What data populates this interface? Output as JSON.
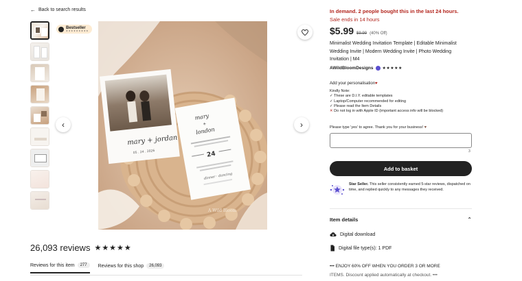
{
  "nav": {
    "back_label": "Back to search results"
  },
  "badge": {
    "label": "Bestseller",
    "sub": "★★★★★★★★★"
  },
  "gallery": {
    "thumbnail_count": 9,
    "card_names": "mary + jordan",
    "card_date": "05 . 24 . 2026",
    "card2_names": "mary + london",
    "card2_day": "24",
    "card_watermark": "A Wild Bloom"
  },
  "reviews": {
    "title": "26,093 reviews",
    "stars": "★★★★★",
    "tabs": [
      {
        "label": "Reviews for this item",
        "count": "277"
      },
      {
        "label": "Reviews for this shop",
        "count": "26,093"
      }
    ]
  },
  "listing": {
    "demand": "In demand. 2 people bought this in the last 24 hours.",
    "sale_ends": "Sale ends in 14 hours",
    "price_now": "$5.99",
    "price_was": "$9.99",
    "discount": "(40% Off)",
    "title": "Minimalist Wedding Invitation Template | Editable Minimalist Wedding Invite | Modern Wedding Invite | Photo Wedding Invitation | M4",
    "shop_name": "AWildBloomDesigns",
    "shop_stars": "★★★★★"
  },
  "personalisation": {
    "label": "Add your personalisation",
    "required_mark": "♥",
    "notes": [
      "Kindly Note:",
      "✓ These are D.I.Y. editable templates",
      "✓ Laptop/Computer recommended for editing",
      "✓ Please read the Item Details"
    ],
    "warning": "Do not log in with Apple ID (important access info will be blocked)",
    "prompt": "Please type 'yes' to agree. Thank you for your business!",
    "counter": "3"
  },
  "cta": {
    "add_to_basket": "Add to basket"
  },
  "star_seller": {
    "title": "Star Seller.",
    "text": "This seller consistently earned 5-star reviews, dispatched on time, and replied quickly to any messages they received."
  },
  "details": {
    "heading": "Item details",
    "items": [
      {
        "icon": "download-icon",
        "label": "Digital download"
      },
      {
        "icon": "file-icon",
        "label": "Digital file type(s): 1 PDF"
      }
    ],
    "promo_line1": "••• ENJOY 60% OFF WHEN YOU ORDER 3 OR MORE",
    "promo_line2": "ITEMS. Discount applied automatically at checkout. •••"
  },
  "colors": {
    "accent_red": "#b3261e",
    "button_dark": "#222222",
    "badge_bg": "#fdebd2",
    "verified": "#5b4fcf"
  }
}
